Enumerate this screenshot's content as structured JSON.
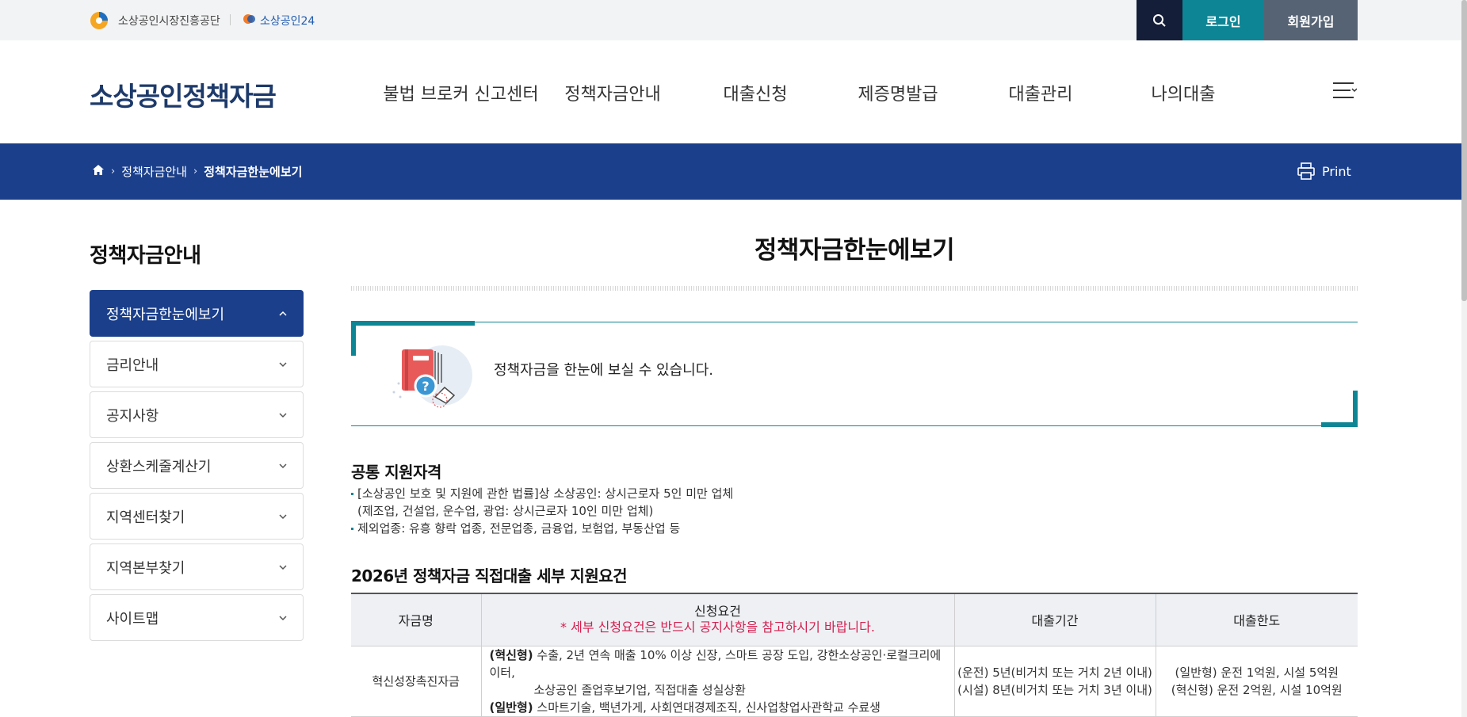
{
  "util": {
    "org_name": "소상공인시장진흥공단",
    "portal_name": "소상공인24",
    "login_label": "로그인",
    "join_label": "회원가입"
  },
  "header": {
    "site_logo": "소상공인정책자금",
    "nav": [
      {
        "label": "불법 브로커 신고센터"
      },
      {
        "label": "정책자금안내"
      },
      {
        "label": "대출신청"
      },
      {
        "label": "제증명발급"
      },
      {
        "label": "대출관리"
      },
      {
        "label": "나의대출"
      }
    ]
  },
  "breadcrumb": {
    "level1": "정책자금안내",
    "level2": "정책자금한눈에보기",
    "print_label": "Print"
  },
  "sidebar": {
    "title": "정책자금안내",
    "items": [
      {
        "label": "정책자금한눈에보기",
        "active": true
      },
      {
        "label": "금리안내",
        "active": false
      },
      {
        "label": "공지사항",
        "active": false
      },
      {
        "label": "상환스케줄계산기",
        "active": false
      },
      {
        "label": "지역센터찾기",
        "active": false
      },
      {
        "label": "지역본부찾기",
        "active": false
      },
      {
        "label": "사이트맵",
        "active": false
      }
    ]
  },
  "content": {
    "page_title": "정책자금한눈에보기",
    "intro_text": "정책자금을 한눈에 보실 수 있습니다.",
    "section1_title": "공통 지원자격",
    "bullet1_line1": "[소상공인 보호 및 지원에 관한 법률]상 소상공인: 상시근로자 5인 미만 업체",
    "bullet1_line2": "(제조업, 건설업, 운수업, 광업: 상시근로자 10인 미만 업체)",
    "bullet2": "제외업종: 유흥 향락 업종, 전문업종, 금융업, 보험업, 부동산업 등",
    "section2_title": "2026년 정책자금 직접대출 세부 지원요건",
    "table": {
      "headers": {
        "name": "자금명",
        "requirement": "신청요건",
        "requirement_note": "* 세부 신청요건은 반드시 공지사항을 참고하시기 바랍니다.",
        "period": "대출기간",
        "limit": "대출한도"
      },
      "rows": [
        {
          "name": "혁신성장촉진자금",
          "req_type1": "(혁신형)",
          "req_text1a": " 수출, 2년 연속 매출 10% 이상 신장, 스마트 공장 도입, 강한소상공인·로컬크리에이터,",
          "req_text1b": "소상공인 졸업후보기업, 직접대출 성실상환",
          "req_type2": "(일반형)",
          "req_text2": " 스마트기술, 백년가게, 사회연대경제조직, 신사업창업사관학교 수료생",
          "period1": "(운전) 5년(비거치 또는 거치 2년 이내)",
          "period2": "(시설) 8년(비거치 또는 거치 3년 이내)",
          "limit1": "(일반형) 운전 1억원, 시설 5억원",
          "limit2": "(혁신형) 운전 2억원, 시설 10억원"
        }
      ]
    }
  },
  "colors": {
    "navy": "#1b3f8b",
    "teal": "#0d8595",
    "dark": "#141e38",
    "gray_btn": "#566374",
    "note_red": "#d3204f"
  }
}
